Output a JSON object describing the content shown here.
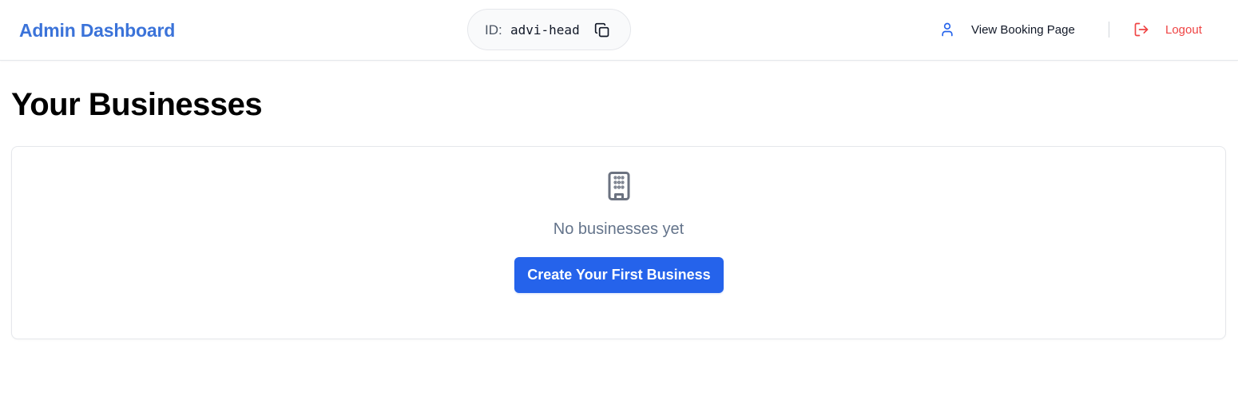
{
  "header": {
    "brand": "Admin Dashboard",
    "id_label": "ID:",
    "id_value": "advi-head",
    "copy_icon": "copy-icon",
    "nav": {
      "booking_label": "View Booking Page",
      "booking_icon": "user-icon",
      "logout_label": "Logout",
      "logout_icon": "logout-icon"
    }
  },
  "main": {
    "title": "Your Businesses",
    "empty_state": {
      "icon": "building-icon",
      "message": "No businesses yet",
      "cta_label": "Create Your First Business"
    }
  },
  "colors": {
    "brand": "#3b73d9",
    "primary": "#2563eb",
    "logout": "#ef4444",
    "muted": "#64748b"
  }
}
